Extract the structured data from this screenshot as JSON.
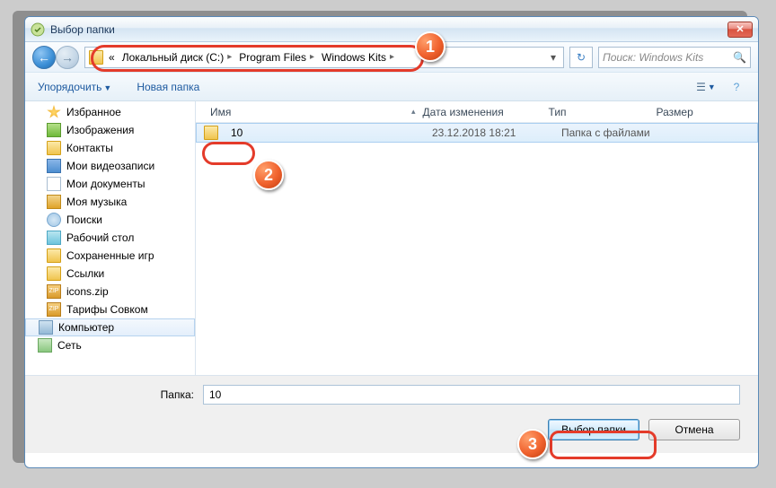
{
  "window": {
    "title": "Выбор папки"
  },
  "nav": {
    "breadcrumb_prefix": "«",
    "segments": [
      "Локальный диск (C:)",
      "Program Files",
      "Windows Kits"
    ],
    "search_placeholder": "Поиск: Windows Kits"
  },
  "toolbar": {
    "organize": "Упорядочить",
    "newfolder": "Новая папка"
  },
  "sidebar": {
    "items": [
      {
        "label": "Избранное",
        "icon": "star"
      },
      {
        "label": "Изображения",
        "icon": "img"
      },
      {
        "label": "Контакты",
        "icon": "folder"
      },
      {
        "label": "Мои видеозаписи",
        "icon": "vid"
      },
      {
        "label": "Мои документы",
        "icon": "doc"
      },
      {
        "label": "Моя музыка",
        "icon": "mus"
      },
      {
        "label": "Поиски",
        "icon": "search"
      },
      {
        "label": "Рабочий стол",
        "icon": "desk"
      },
      {
        "label": "Сохраненные игр",
        "icon": "folder"
      },
      {
        "label": "Ссылки",
        "icon": "folder"
      },
      {
        "label": "icons.zip",
        "icon": "zip"
      },
      {
        "label": "Тарифы Совком",
        "icon": "zip"
      },
      {
        "label": "Компьютер",
        "icon": "comp",
        "selected": true
      },
      {
        "label": "Сеть",
        "icon": "net"
      }
    ]
  },
  "columns": {
    "name": "Имя",
    "date": "Дата изменения",
    "type": "Тип",
    "size": "Размер"
  },
  "files": [
    {
      "name": "10",
      "date": "23.12.2018 18:21",
      "type": "Папка с файлами",
      "size": ""
    }
  ],
  "footer": {
    "folder_label": "Папка:",
    "folder_value": "10",
    "select": "Выбор папки",
    "cancel": "Отмена"
  },
  "callouts": {
    "c1": "1",
    "c2": "2",
    "c3": "3"
  }
}
